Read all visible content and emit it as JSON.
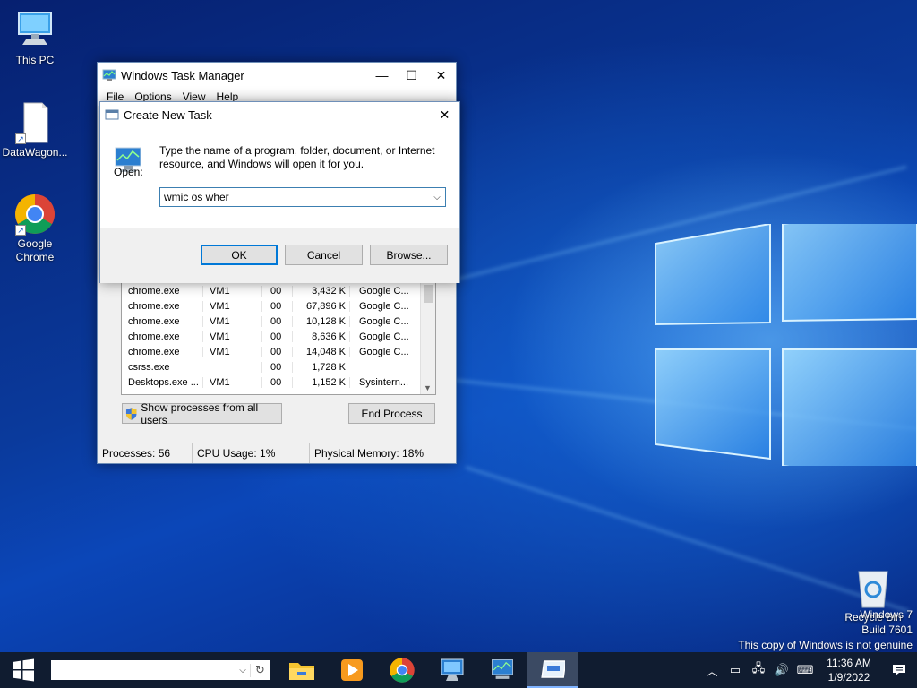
{
  "desktop": {
    "icons": [
      {
        "label": "This PC",
        "icon": "this-pc-icon"
      },
      {
        "label": "DataWagon...",
        "icon": "file-shortcut-icon"
      },
      {
        "label": "Google Chrome",
        "icon": "chrome-icon"
      },
      {
        "label": "Recycle Bin",
        "icon": "recycle-bin-icon"
      }
    ],
    "watermark": {
      "line1": "Windows 7",
      "line2": "Build 7601",
      "line3": "This copy of Windows is not genuine"
    }
  },
  "task_manager": {
    "title": "Windows Task Manager",
    "menu": [
      "File",
      "Options",
      "View",
      "Help"
    ],
    "processes": [
      {
        "name": "chrome.exe",
        "user": "VM1",
        "cpu": "00",
        "mem": "3,432 K",
        "desc": "Google C..."
      },
      {
        "name": "chrome.exe",
        "user": "VM1",
        "cpu": "00",
        "mem": "67,896 K",
        "desc": "Google C..."
      },
      {
        "name": "chrome.exe",
        "user": "VM1",
        "cpu": "00",
        "mem": "10,128 K",
        "desc": "Google C..."
      },
      {
        "name": "chrome.exe",
        "user": "VM1",
        "cpu": "00",
        "mem": "8,636 K",
        "desc": "Google C..."
      },
      {
        "name": "chrome.exe",
        "user": "VM1",
        "cpu": "00",
        "mem": "14,048 K",
        "desc": "Google C..."
      },
      {
        "name": "csrss.exe",
        "user": "",
        "cpu": "00",
        "mem": "1,728 K",
        "desc": ""
      },
      {
        "name": "Desktops.exe ...",
        "user": "VM1",
        "cpu": "00",
        "mem": "1,152 K",
        "desc": "Sysintern..."
      }
    ],
    "show_all_label": "Show processes from all users",
    "end_process_label": "End Process",
    "status": {
      "processes": "Processes: 56",
      "cpu": "CPU Usage: 1%",
      "memory": "Physical Memory: 18%"
    }
  },
  "create_task": {
    "title": "Create New Task",
    "description": "Type the name of a program, folder, document, or Internet resource, and Windows will open it for you.",
    "open_label": "Open:",
    "open_value": "wmic os wher",
    "ok_label": "OK",
    "cancel_label": "Cancel",
    "browse_label": "Browse..."
  },
  "taskbar": {
    "search_value": "",
    "apps": [
      {
        "icon": "file-explorer-icon",
        "active": false
      },
      {
        "icon": "media-player-icon",
        "active": false
      },
      {
        "icon": "chrome-icon",
        "active": false
      },
      {
        "icon": "remote-desktop-icon",
        "active": false
      },
      {
        "icon": "task-manager-icon",
        "active": false
      },
      {
        "icon": "run-dialog-icon",
        "active": true
      }
    ],
    "clock_time": "11:36 AM",
    "clock_date": "1/9/2022"
  }
}
